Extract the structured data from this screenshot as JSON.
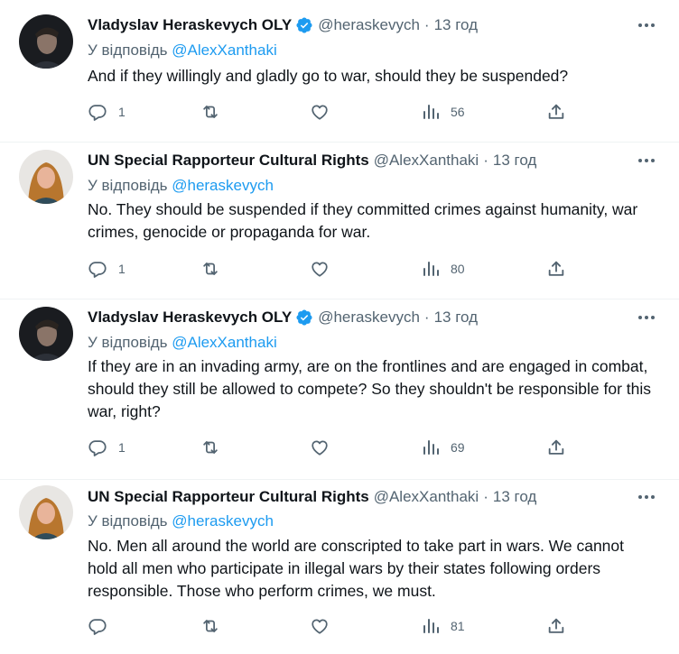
{
  "tweets": [
    {
      "author": "Vladyslav Heraskevych OLY",
      "handle": "@heraskevych",
      "time": "13 год",
      "verified": true,
      "reply_prefix": "У відповідь",
      "reply_to": "@AlexXanthaki",
      "text": "And if they willingly and gladly go to war, should they be suspended?",
      "replies": "1",
      "retweets": "",
      "likes": "",
      "views": "56"
    },
    {
      "author": "UN Special Rapporteur Cultural Rights",
      "handle": "@AlexXanthaki",
      "time": "13 год",
      "verified": false,
      "reply_prefix": "У відповідь",
      "reply_to": "@heraskevych",
      "text": "No. They should be suspended if they committed crimes against humanity, war crimes, genocide or propaganda for war.",
      "replies": "1",
      "retweets": "",
      "likes": "",
      "views": "80"
    },
    {
      "author": "Vladyslav Heraskevych OLY",
      "handle": "@heraskevych",
      "time": "13 год",
      "verified": true,
      "reply_prefix": "У відповідь",
      "reply_to": "@AlexXanthaki",
      "text": "If they are in an invading army, are on the frontlines and are engaged in combat, should they still be allowed to compete? So they shouldn't be responsible for this war, right?",
      "replies": "1",
      "retweets": "",
      "likes": "",
      "views": "69"
    },
    {
      "author": "UN Special Rapporteur Cultural Rights",
      "handle": "@AlexXanthaki",
      "time": "13 год",
      "verified": false,
      "reply_prefix": "У відповідь",
      "reply_to": "@heraskevych",
      "text": "No. Men all around the world are conscripted to take part in wars. We cannot hold all men who participate in illegal wars by their states following orders responsible. Those who perform crimes, we must.",
      "replies": "",
      "retweets": "",
      "likes": "",
      "views": "81"
    }
  ],
  "separator": "·",
  "icons": {
    "verified": "verified-badge-icon",
    "more": "more-dots-icon",
    "reply": "reply-bubble-icon",
    "retweet": "retweet-icon",
    "like": "heart-icon",
    "views": "views-bar-chart-icon",
    "share": "share-upload-icon"
  },
  "colors": {
    "text": "#0f1419",
    "secondary": "#536471",
    "link": "#1d9bf0",
    "verified": "#1d9bf0"
  }
}
